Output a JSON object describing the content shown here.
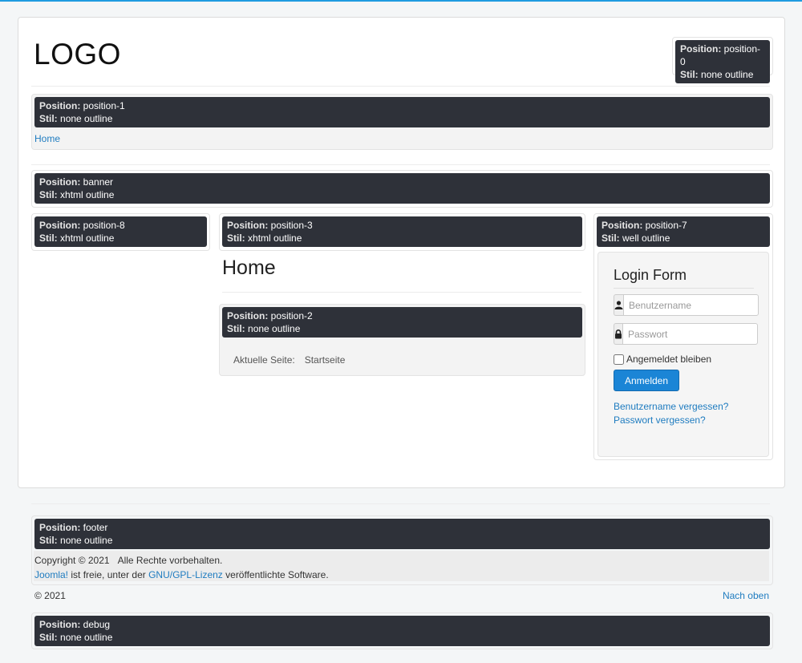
{
  "header": {
    "logo": "LOGO"
  },
  "positions": {
    "position_0": {
      "label": "Position:",
      "name": "position-0",
      "style_label": "Stil:",
      "style": "none outline"
    },
    "position_1": {
      "label": "Position:",
      "name": "position-1",
      "style_label": "Stil:",
      "style": "none outline"
    },
    "banner": {
      "label": "Position:",
      "name": "banner",
      "style_label": "Stil:",
      "style": "xhtml outline"
    },
    "position_8": {
      "label": "Position:",
      "name": "position-8",
      "style_label": "Stil:",
      "style": "xhtml outline"
    },
    "position_3": {
      "label": "Position:",
      "name": "position-3",
      "style_label": "Stil:",
      "style": "xhtml outline"
    },
    "position_2": {
      "label": "Position:",
      "name": "position-2",
      "style_label": "Stil:",
      "style": "none outline"
    },
    "position_7": {
      "label": "Position:",
      "name": "position-7",
      "style_label": "Stil:",
      "style": "well outline"
    },
    "footer": {
      "label": "Position:",
      "name": "footer",
      "style_label": "Stil:",
      "style": "none outline"
    },
    "debug": {
      "label": "Position:",
      "name": "debug",
      "style_label": "Stil:",
      "style": "none outline"
    }
  },
  "nav": {
    "home_link": "Home"
  },
  "content": {
    "page_heading": "Home",
    "breadcrumb_label": "Aktuelle Seite:",
    "breadcrumb_current": "Startseite"
  },
  "login": {
    "title": "Login Form",
    "username_placeholder": "Benutzername",
    "password_placeholder": "Passwort",
    "remember_label": "Angemeldet bleiben",
    "submit_label": "Anmelden",
    "forgot_username": "Benutzername vergessen?",
    "forgot_password": "Passwort vergessen?"
  },
  "footer": {
    "copyright": "Copyright © 2021",
    "rights": "Alle Rechte vorbehalten.",
    "joomla_link": "Joomla!",
    "free_text": "ist freie, unter der",
    "license_link": "GNU/GPL-Lizenz",
    "released_text": "veröffentlichte Software.",
    "year": "© 2021",
    "back_to_top": "Nach oben"
  },
  "colors": {
    "accent": "#1f9ce0",
    "label_bg": "#2e3139",
    "button": "#1b85d6"
  }
}
